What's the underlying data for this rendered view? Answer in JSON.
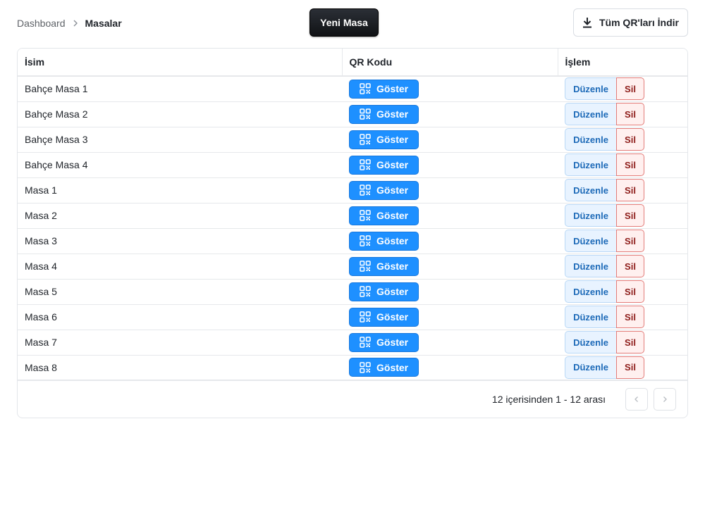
{
  "breadcrumb": {
    "parent": "Dashboard",
    "current": "Masalar"
  },
  "toolbar": {
    "new_label": "Yeni Masa",
    "download_label": "Tüm QR'ları İndir"
  },
  "table": {
    "columns": {
      "name": "İsim",
      "qr": "QR Kodu",
      "action": "İşlem"
    },
    "rows": [
      {
        "name": "Bahçe Masa 1"
      },
      {
        "name": "Bahçe Masa 2"
      },
      {
        "name": "Bahçe Masa 3"
      },
      {
        "name": "Bahçe Masa 4"
      },
      {
        "name": "Masa 1"
      },
      {
        "name": "Masa 2"
      },
      {
        "name": "Masa 3"
      },
      {
        "name": "Masa 4"
      },
      {
        "name": "Masa 5"
      },
      {
        "name": "Masa 6"
      },
      {
        "name": "Masa 7"
      },
      {
        "name": "Masa 8"
      }
    ],
    "show_label": "Göster",
    "edit_label": "Düzenle",
    "delete_label": "Sil"
  },
  "pagination": {
    "info": "12 içerisinden 1 - 12 arası"
  },
  "icons": {
    "breadcrumb_separator": "chevron-right-icon",
    "download": "download-icon",
    "qr": "qr-code-icon",
    "prev": "chevron-left-icon",
    "next": "chevron-right-icon"
  },
  "colors": {
    "primary": "#1e90ff",
    "dark_button": "#16191d",
    "edit_bg": "#e8f3ff",
    "edit_text": "#1d6ab8",
    "delete_bg": "#fff0ef",
    "delete_border": "#e37b78",
    "delete_text": "#8e1d1a"
  }
}
